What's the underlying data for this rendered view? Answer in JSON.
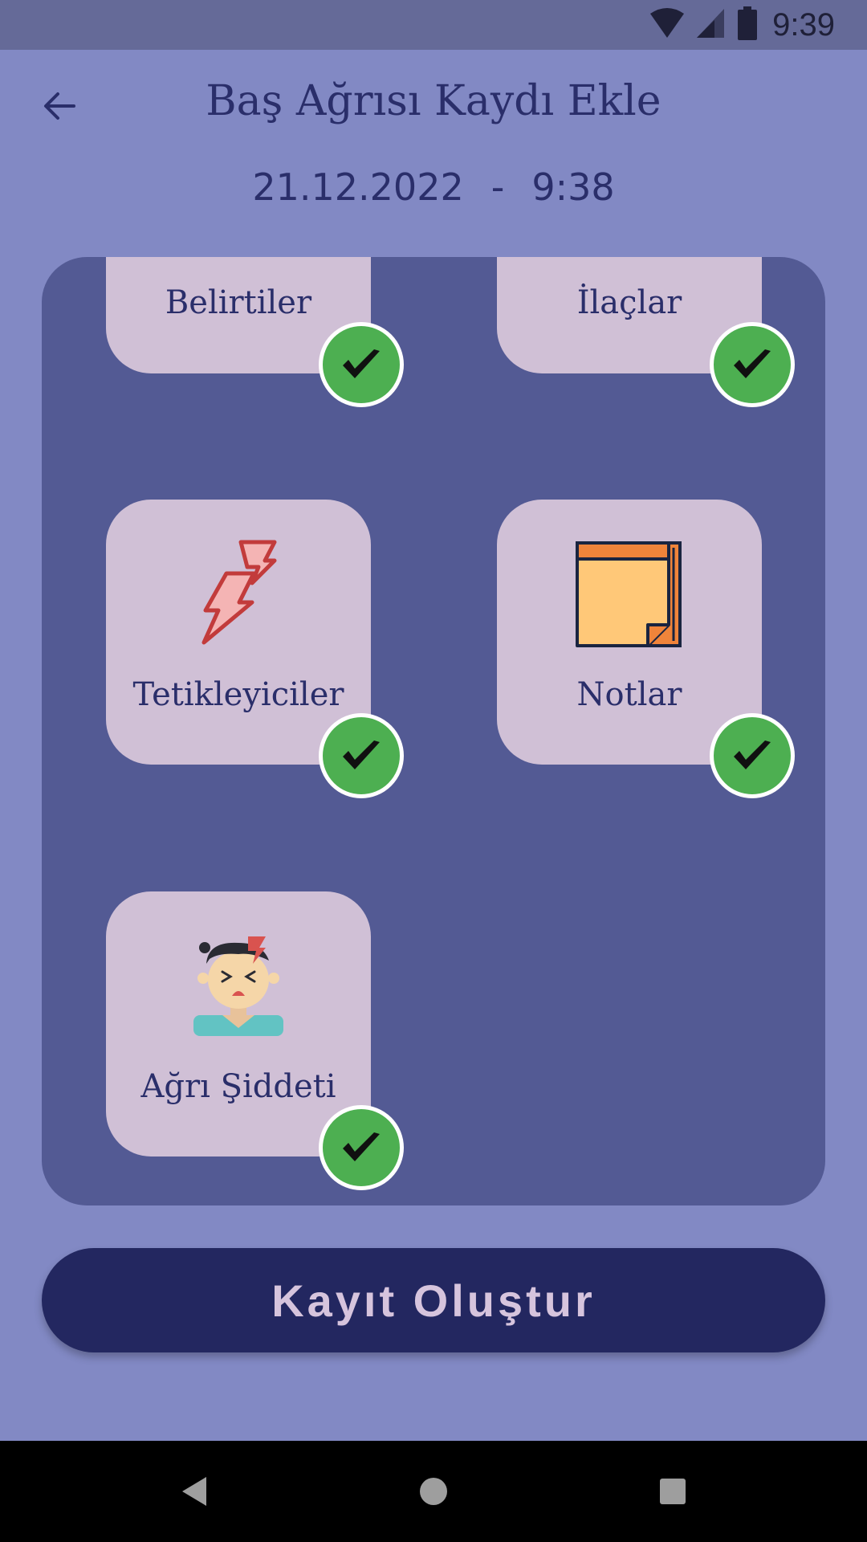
{
  "status_bar": {
    "time": "9:39"
  },
  "header": {
    "title": "Baş Ağrısı Kaydı Ekle",
    "date": "21.12.2022",
    "separator": "-",
    "time": "9:38"
  },
  "cards": {
    "symptoms": {
      "label": "Belirtiler",
      "completed": true
    },
    "medications": {
      "label": "İlaçlar",
      "completed": true
    },
    "triggers": {
      "label": "Tetikleyiciler",
      "completed": true
    },
    "notes": {
      "label": "Notlar",
      "completed": true
    },
    "pain_severity": {
      "label": "Ağrı Şiddeti",
      "completed": true
    }
  },
  "primary_button": {
    "label": "Kayıt Oluştur"
  },
  "colors": {
    "background": "#8289c4",
    "panel": "#535a94",
    "card": "#d0c0d6",
    "accent_dark": "#232760",
    "check_green": "#4daf51"
  }
}
